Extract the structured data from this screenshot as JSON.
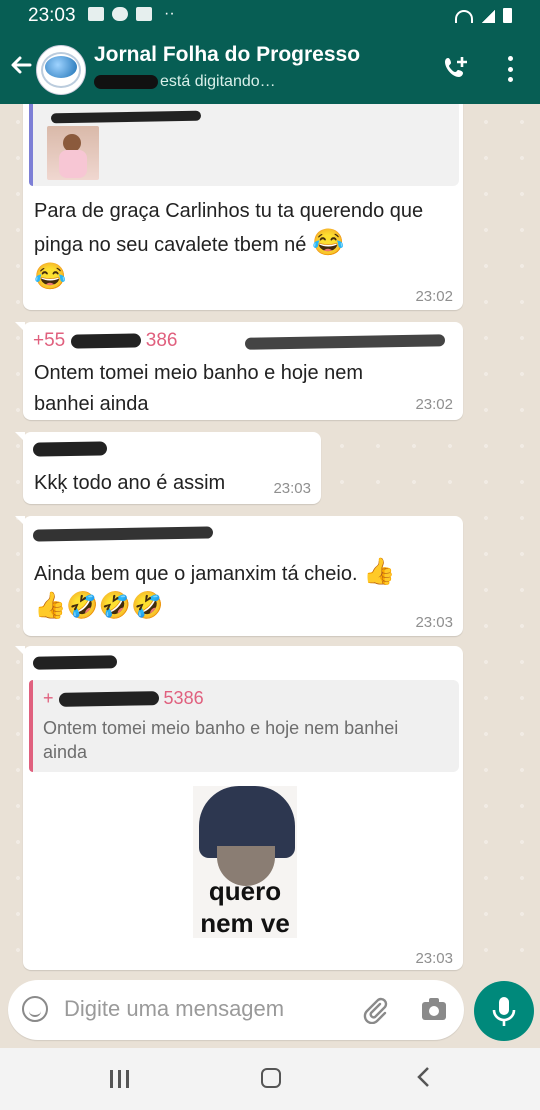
{
  "status_bar": {
    "time": "23:03"
  },
  "header": {
    "title": "Jornal Folha do Progresso",
    "subtitle": "está digitando…"
  },
  "messages": [
    {
      "id": "m1",
      "text": "Para de graça Carlinhos tu ta querendo que pinga no seu cavalete tbem né",
      "emoji_inline": "😂",
      "emoji_trailing": "😂",
      "time": "23:02"
    },
    {
      "id": "m2",
      "sender_prefix": "+55",
      "sender_suffix": "386",
      "text": "Ontem tomei meio banho e hoje nem banhei ainda",
      "time": "23:02"
    },
    {
      "id": "m3",
      "text": "Kkķ todo ano é assim",
      "time": "23:03"
    },
    {
      "id": "m4",
      "text": "Ainda bem que o jamanxim tá cheio.",
      "emoji_inline": "👍",
      "emoji_line2": "👍🤣🤣🤣",
      "time": "23:03"
    },
    {
      "id": "m5",
      "quote_prefix": "+",
      "quote_suffix": "5386",
      "quote_text": "Ontem tomei meio banho e hoje nem banhei ainda",
      "sticker_line1": "quero",
      "sticker_line2": "nem ve",
      "time": "23:03"
    }
  ],
  "composer": {
    "placeholder": "Digite uma mensagem"
  },
  "colors": {
    "header": "#075e54",
    "accent": "#00897b",
    "sender_red": "#e0607e",
    "chat_bg": "#e9e1d6"
  },
  "icons": [
    "back-arrow-icon",
    "add-call-icon",
    "more-options-icon",
    "emoji-icon",
    "attach-icon",
    "camera-icon",
    "mic-icon"
  ]
}
